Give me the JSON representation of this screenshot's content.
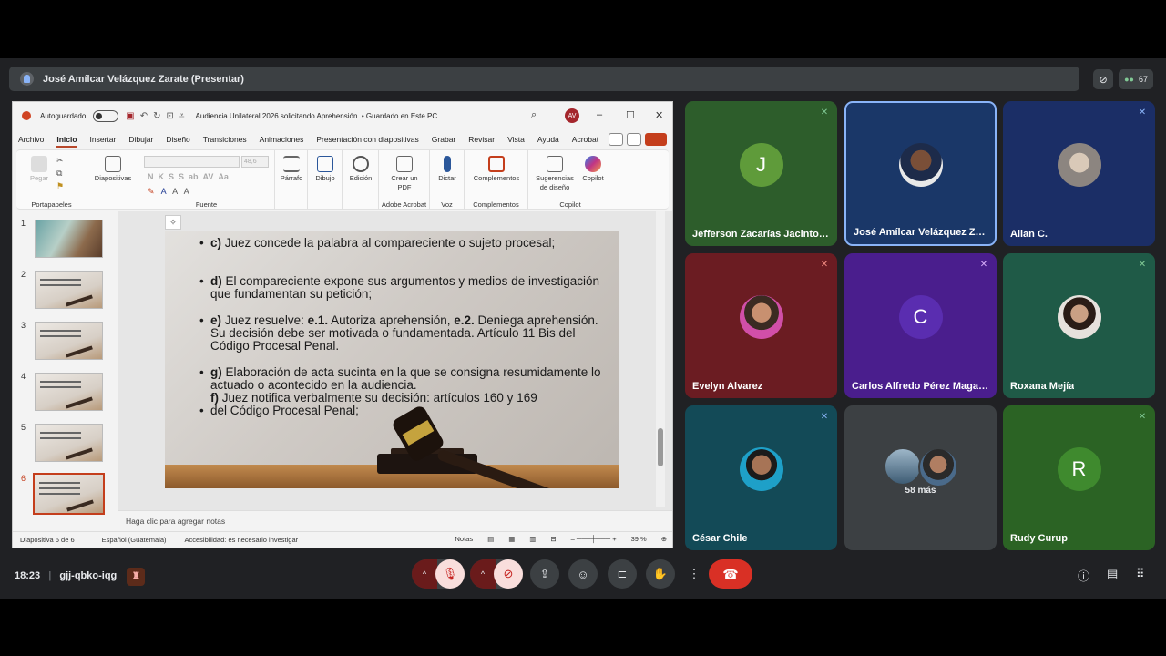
{
  "presenter_bar": {
    "title": "José Amílcar Velázquez Zarate (Presentar)",
    "people_count": "67"
  },
  "ppt": {
    "autosave_label": "Autoguardado",
    "doc_title": "Audiencia Unilateral 2026 solicitando Aprehensión. • Guardado en Este PC",
    "user_initials": "AV",
    "menu": [
      "Archivo",
      "Inicio",
      "Insertar",
      "Dibujar",
      "Diseño",
      "Transiciones",
      "Animaciones",
      "Presentación con diapositivas",
      "Grabar",
      "Revisar",
      "Vista",
      "Ayuda",
      "Acrobat"
    ],
    "ribbon": {
      "pegar": "Pegar",
      "portapapeles": "Portapapeles",
      "diapositivas": "Diapositivas",
      "fuente": "Fuente",
      "font_size": "48,6",
      "parrafo": "Párrafo",
      "dibujo": "Dibujo",
      "edicion": "Edición",
      "crear_pdf": "Crear un PDF",
      "adobe": "Adobe Acrobat",
      "dictar": "Dictar",
      "voz": "Voz",
      "complementos": "Complementos",
      "sugerencias": "Sugerencias de diseño",
      "copilot": "Copilot",
      "copilot_group": "Copilot"
    },
    "slide_numbers": [
      "1",
      "2",
      "3",
      "4",
      "5",
      "6"
    ],
    "slide": {
      "c_label": "c)",
      "c_text": "Juez concede la palabra al compareciente o sujeto procesal;",
      "d_label": "d)",
      "d_text": "El compareciente expone sus argumentos y medios de investigación que fundamentan su petición;",
      "e_label": "e)",
      "e_text1": "Juez resuelve:",
      "e1": "e.1.",
      "e_text2": "Autoriza aprehensión,",
      "e2": "e.2.",
      "e_text3": "Deniega aprehensión. Su decisión debe ser motivada o fundamentada. Artículo 11 Bis del Código Procesal Penal.",
      "g_label": "g)",
      "g_text": "Elaboración de acta sucinta en la que se consigna resumidamente lo actuado o acontecido en la audiencia.",
      "f_label": "f)",
      "f_text": "Juez notifica verbalmente su decisión: artículos 160 y 169",
      "f_text2": "del Código Procesal Penal;"
    },
    "notes_placeholder": "Haga clic para agregar notas",
    "status": {
      "slide": "Diapositiva 6 de 6",
      "lang": "Español (Guatemala)",
      "access": "Accesibilidad: es necesario investigar",
      "notas": "Notas",
      "zoom": "39 %"
    }
  },
  "participants": [
    {
      "name": "Jefferson Zacarías Jacinto ...",
      "initial": "J",
      "color": "#5f9b3a",
      "bg": "#2d5d2b"
    },
    {
      "name": "José Amílcar Velázquez Zar...",
      "bg": "#1a3768"
    },
    {
      "name": "Allan C.",
      "bg": "#1b2e66"
    },
    {
      "name": "Evelyn Alvarez",
      "bg": "#6b1c22"
    },
    {
      "name": "Carlos Alfredo Pérez Magaña",
      "initial": "C",
      "color": "#5a2db0",
      "bg": "#4a1e8d"
    },
    {
      "name": "Roxana Mejía",
      "bg": "#1f5a47"
    },
    {
      "name": "César Chile",
      "bg": "#134a57"
    },
    {
      "more": "58 más",
      "bg": "#3c4043"
    },
    {
      "name": "Rudy Curup",
      "initial": "R",
      "color": "#3f8a2e",
      "bg": "#2b6324"
    }
  ],
  "bottom": {
    "time": "18:23",
    "meeting_code": "gjj-qbko-iqg"
  }
}
